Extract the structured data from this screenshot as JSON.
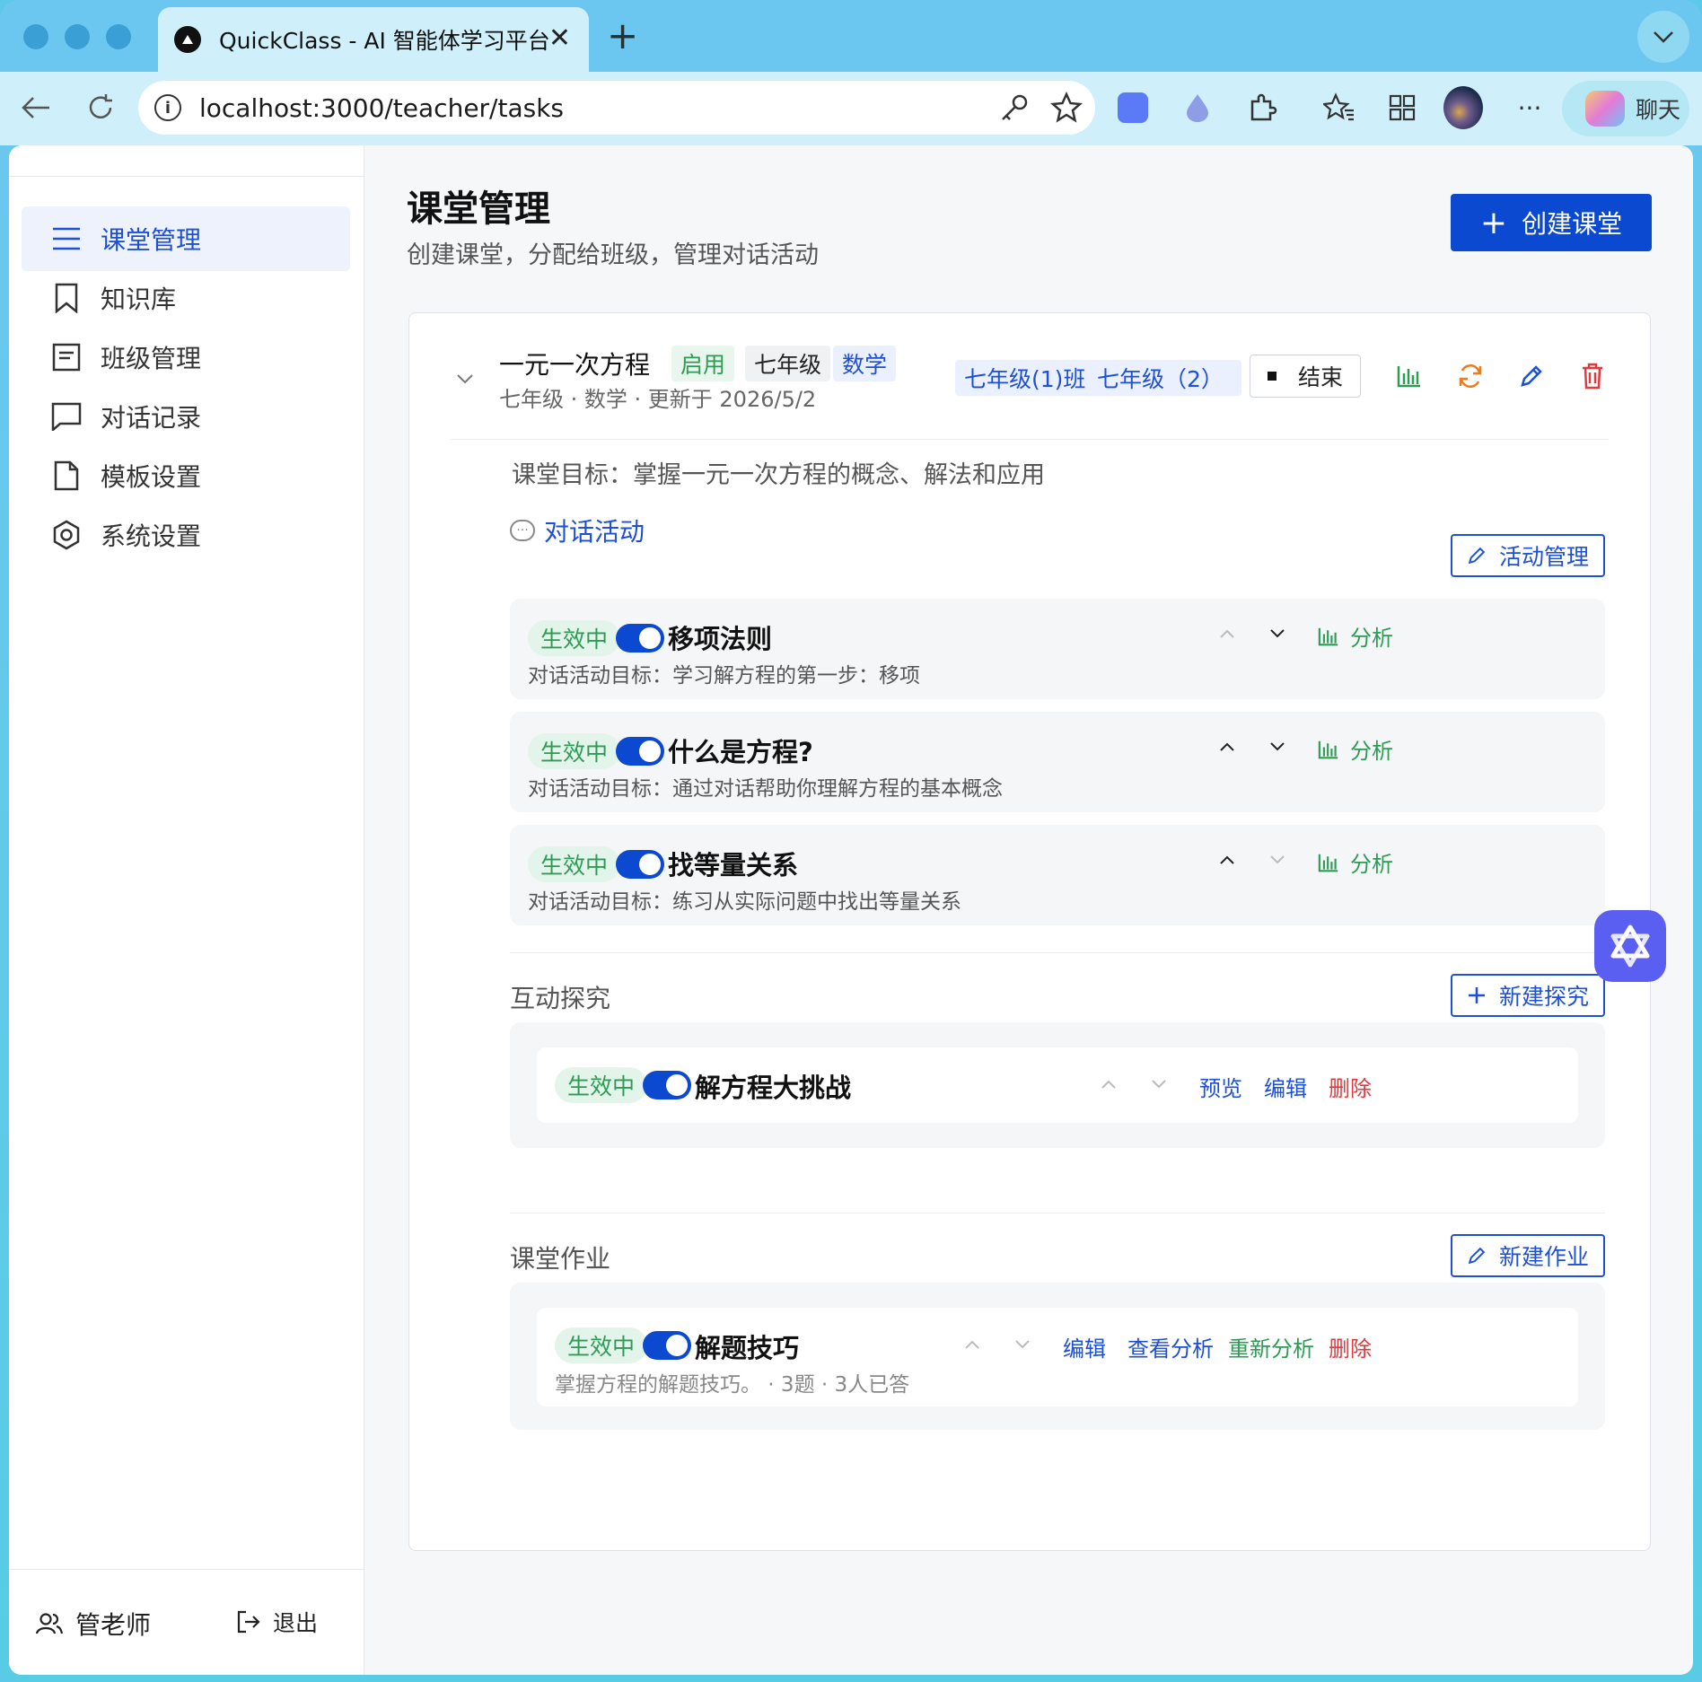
{
  "browser": {
    "tab_title": "QuickClass - AI 智能体学习平台",
    "url": "localhost:3000/teacher/tasks",
    "chat_label": "聊天"
  },
  "sidebar": {
    "items": [
      {
        "label": "课堂管理",
        "icon": "menu-icon",
        "active": true
      },
      {
        "label": "知识库",
        "icon": "bookmark-icon"
      },
      {
        "label": "班级管理",
        "icon": "clipboard-icon"
      },
      {
        "label": "对话记录",
        "icon": "chat-icon"
      },
      {
        "label": "模板设置",
        "icon": "file-icon"
      },
      {
        "label": "系统设置",
        "icon": "settings-icon"
      }
    ],
    "user_name": "管老师",
    "logout_label": "退出"
  },
  "header": {
    "title": "课堂管理",
    "subtitle": "创建课堂，分配给班级，管理对话活动",
    "create_button": "创建课堂"
  },
  "classroom": {
    "title": "一元一次方程",
    "tags": [
      "启用",
      "七年级",
      "数学"
    ],
    "meta": "七年级 · 数学 · 更新于 2026/5/2",
    "classes": [
      "七年级(1)班",
      "七年级（2）"
    ],
    "end_button": "结束",
    "goal": "课堂目标：掌握一元一次方程的概念、解法和应用",
    "dialog_section": {
      "title": "对话活动",
      "manage_button": "活动管理",
      "activities": [
        {
          "status": "生效中",
          "title": "移项法则",
          "desc": "对话活动目标：学习解方程的第一步：移项",
          "analyze": "分析"
        },
        {
          "status": "生效中",
          "title": "什么是方程?",
          "desc": "对话活动目标：通过对话帮助你理解方程的基本概念",
          "analyze": "分析"
        },
        {
          "status": "生效中",
          "title": "找等量关系",
          "desc": "对话活动目标：练习从实际问题中找出等量关系",
          "analyze": "分析"
        }
      ]
    },
    "inquiry_section": {
      "title": "互动探究",
      "new_button": "新建探究",
      "item": {
        "status": "生效中",
        "title": "解方程大挑战",
        "preview": "预览",
        "edit": "编辑",
        "delete": "删除"
      }
    },
    "homework_section": {
      "title": "课堂作业",
      "new_button": "新建作业",
      "item": {
        "status": "生效中",
        "title": "解题技巧",
        "desc": "掌握方程的解题技巧。 · 3题 · 3人已答",
        "edit": "编辑",
        "view_analysis": "查看分析",
        "reanalyze": "重新分析",
        "delete": "删除"
      }
    }
  },
  "colors": {
    "primary": "#0c49d1",
    "success": "#2e9b55",
    "danger": "#e0393e",
    "warning": "#f07a1a"
  }
}
